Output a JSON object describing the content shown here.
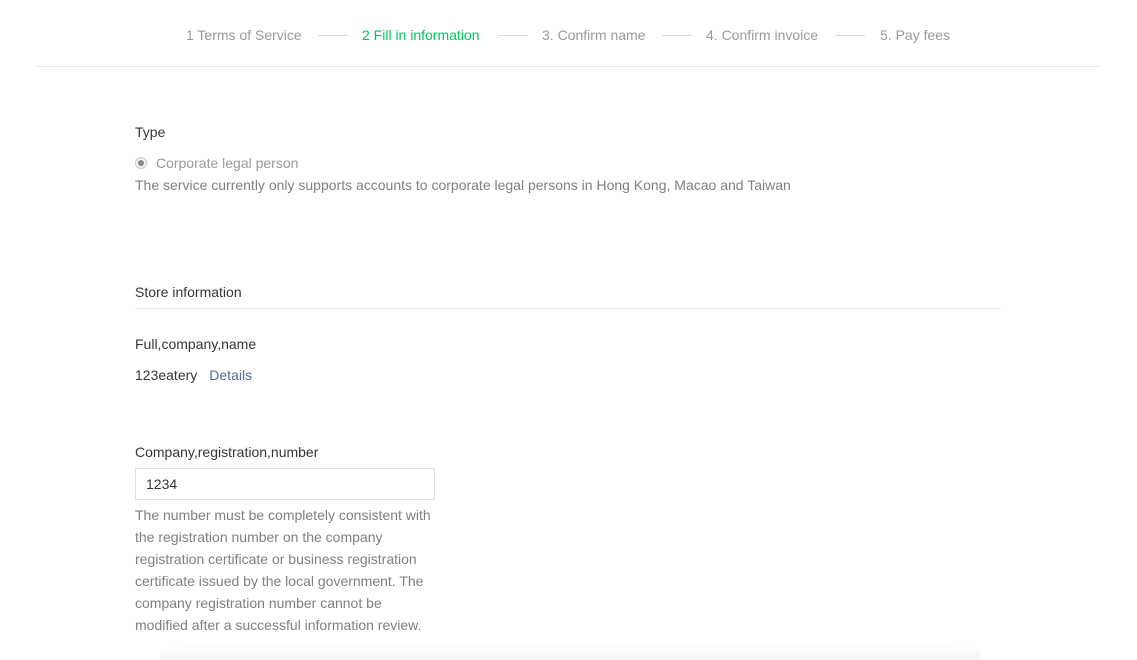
{
  "steps": [
    {
      "label": "1 Terms of Service",
      "state": "done"
    },
    {
      "label": "2 Fill in information",
      "state": "active"
    },
    {
      "label": "3. Confirm name",
      "state": "pending"
    },
    {
      "label": "4. Confirm invoice",
      "state": "pending"
    },
    {
      "label": "5. Pay fees",
      "state": "pending"
    }
  ],
  "colors": {
    "active_step": "#07c160",
    "link": "#576b95",
    "muted_text": "#9a9a9a"
  },
  "type_section": {
    "label": "Type",
    "option_label": "Corporate legal person",
    "option_selected": true,
    "note": "The service currently only supports accounts to corporate legal persons in Hong Kong, Macao and Taiwan"
  },
  "store_section": {
    "title": "Store information",
    "company_name_label": "Full,company,name",
    "company_name_value": "123eatery",
    "details_link": "Details",
    "registration_label": "Company,registration,number",
    "registration_value": "1234",
    "registration_note": "The number must be completely consistent with the registration number on the company registration certificate or business registration certificate issued by the local government. The company registration number cannot be modified after a successful information review."
  }
}
